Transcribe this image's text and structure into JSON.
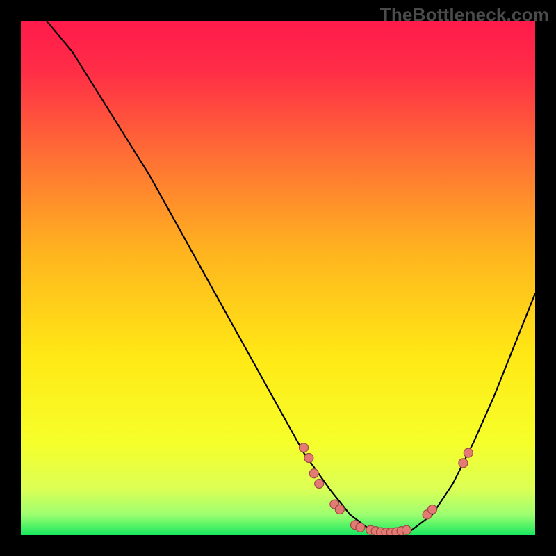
{
  "watermark": "TheBottleneck.com",
  "colors": {
    "frame": "#000000",
    "curve": "#000000",
    "dot_fill": "#e47a74",
    "dot_stroke": "#9d4a45",
    "gradient_stops": [
      {
        "offset": 0.0,
        "color": "#ff1a4b"
      },
      {
        "offset": 0.1,
        "color": "#ff2e46"
      },
      {
        "offset": 0.25,
        "color": "#ff6a36"
      },
      {
        "offset": 0.45,
        "color": "#ffb41f"
      },
      {
        "offset": 0.65,
        "color": "#ffe815"
      },
      {
        "offset": 0.82,
        "color": "#f6ff2a"
      },
      {
        "offset": 0.91,
        "color": "#dcff55"
      },
      {
        "offset": 0.96,
        "color": "#9dff70"
      },
      {
        "offset": 1.0,
        "color": "#18e85f"
      }
    ]
  },
  "chart_data": {
    "type": "line",
    "title": "",
    "xlabel": "",
    "ylabel": "",
    "xlim": [
      0,
      100
    ],
    "ylim": [
      0,
      100
    ],
    "curve": [
      {
        "x": 5,
        "y": 100
      },
      {
        "x": 10,
        "y": 94
      },
      {
        "x": 15,
        "y": 86
      },
      {
        "x": 20,
        "y": 78
      },
      {
        "x": 25,
        "y": 70
      },
      {
        "x": 30,
        "y": 61
      },
      {
        "x": 35,
        "y": 52
      },
      {
        "x": 40,
        "y": 43
      },
      {
        "x": 45,
        "y": 34
      },
      {
        "x": 50,
        "y": 25
      },
      {
        "x": 55,
        "y": 16
      },
      {
        "x": 60,
        "y": 9
      },
      {
        "x": 64,
        "y": 4
      },
      {
        "x": 68,
        "y": 1
      },
      {
        "x": 72,
        "y": 0
      },
      {
        "x": 76,
        "y": 1
      },
      {
        "x": 80,
        "y": 4
      },
      {
        "x": 84,
        "y": 10
      },
      {
        "x": 88,
        "y": 18
      },
      {
        "x": 92,
        "y": 27
      },
      {
        "x": 96,
        "y": 37
      },
      {
        "x": 100,
        "y": 47
      }
    ],
    "series": [
      {
        "name": "points",
        "values": [
          {
            "x": 55,
            "y": 17
          },
          {
            "x": 56,
            "y": 15
          },
          {
            "x": 57,
            "y": 12
          },
          {
            "x": 58,
            "y": 10
          },
          {
            "x": 61,
            "y": 6
          },
          {
            "x": 62,
            "y": 5
          },
          {
            "x": 65,
            "y": 2
          },
          {
            "x": 66,
            "y": 1.5
          },
          {
            "x": 68,
            "y": 1
          },
          {
            "x": 69,
            "y": 0.8
          },
          {
            "x": 70,
            "y": 0.6
          },
          {
            "x": 71,
            "y": 0.5
          },
          {
            "x": 72,
            "y": 0.5
          },
          {
            "x": 73,
            "y": 0.6
          },
          {
            "x": 74,
            "y": 0.8
          },
          {
            "x": 75,
            "y": 1
          },
          {
            "x": 79,
            "y": 4
          },
          {
            "x": 80,
            "y": 5
          },
          {
            "x": 86,
            "y": 14
          },
          {
            "x": 87,
            "y": 16
          }
        ]
      }
    ]
  }
}
